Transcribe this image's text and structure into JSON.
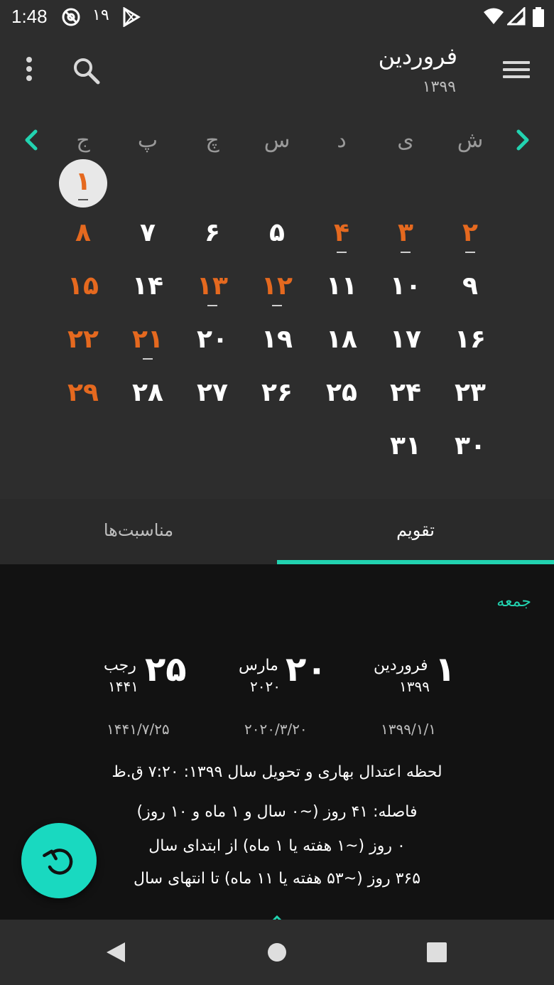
{
  "status_bar": {
    "time": "1:48",
    "notification_count": "۱۹"
  },
  "header": {
    "month": "فروردین",
    "year": "۱۳۹۹"
  },
  "weekdays": [
    "ش",
    "ی",
    "د",
    "س",
    "چ",
    "پ",
    "ج"
  ],
  "days": [
    {
      "label": "۱",
      "holiday": true,
      "event": true,
      "selected": true
    },
    {
      "label": "۲",
      "holiday": true,
      "event": true
    },
    {
      "label": "۳",
      "holiday": true,
      "event": true
    },
    {
      "label": "۴",
      "holiday": true,
      "event": true
    },
    {
      "label": "۵",
      "holiday": false,
      "event": false
    },
    {
      "label": "۶",
      "holiday": false,
      "event": false
    },
    {
      "label": "۷",
      "holiday": false,
      "event": false
    },
    {
      "label": "۸",
      "holiday": true,
      "event": false
    },
    {
      "label": "۹",
      "holiday": false,
      "event": false
    },
    {
      "label": "۱۰",
      "holiday": false,
      "event": false
    },
    {
      "label": "۱۱",
      "holiday": false,
      "event": false
    },
    {
      "label": "۱۲",
      "holiday": true,
      "event": true
    },
    {
      "label": "۱۳",
      "holiday": true,
      "event": true
    },
    {
      "label": "۱۴",
      "holiday": false,
      "event": false
    },
    {
      "label": "۱۵",
      "holiday": true,
      "event": false
    },
    {
      "label": "۱۶",
      "holiday": false,
      "event": false
    },
    {
      "label": "۱۷",
      "holiday": false,
      "event": false
    },
    {
      "label": "۱۸",
      "holiday": false,
      "event": false
    },
    {
      "label": "۱۹",
      "holiday": false,
      "event": false
    },
    {
      "label": "۲۰",
      "holiday": false,
      "event": false
    },
    {
      "label": "۲۱",
      "holiday": true,
      "event": true
    },
    {
      "label": "۲۲",
      "holiday": true,
      "event": false
    },
    {
      "label": "۲۳",
      "holiday": false,
      "event": false
    },
    {
      "label": "۲۴",
      "holiday": false,
      "event": false
    },
    {
      "label": "۲۵",
      "holiday": false,
      "event": false
    },
    {
      "label": "۲۶",
      "holiday": false,
      "event": false
    },
    {
      "label": "۲۷",
      "holiday": false,
      "event": false
    },
    {
      "label": "۲۸",
      "holiday": false,
      "event": false
    },
    {
      "label": "۲۹",
      "holiday": true,
      "event": false
    },
    {
      "label": "۳۰",
      "holiday": false,
      "event": false
    },
    {
      "label": "۳۱",
      "holiday": false,
      "event": false
    }
  ],
  "tabs": {
    "calendar": "تقویم",
    "events": "مناسبت‌ها"
  },
  "details": {
    "weekday": "جمعه",
    "persian": {
      "day": "۱",
      "month": "فروردین",
      "year": "۱۳۹۹",
      "numeric": "۱۳۹۹/۱/۱"
    },
    "gregorian": {
      "day": "۲۰",
      "month": "مارس",
      "year": "۲۰۲۰",
      "numeric": "۲۰۲۰/۳/۲۰"
    },
    "hijri": {
      "day": "۲۵",
      "month": "رجب",
      "year": "۱۴۴۱",
      "numeric": "۱۴۴۱/۷/۲۵"
    },
    "equinox": "لحظه اعتدال بهاری و تحویل سال ۱۳۹۹: ۷:۲۰ ق.ظ",
    "distance": "فاصله: ۴۱ روز (~۰ سال و ۱ ماه و ۱۰ روز)",
    "since_start": "۰ روز (~۱ هفته یا ۱ ماه) از ابتدای سال",
    "until_end": "۳۶۵ روز (~۵۳ هفته یا ۱۱ ماه) تا انتهای سال"
  },
  "colors": {
    "accent": "#22d3b0",
    "holiday": "#e5691f",
    "fab": "#19d9c0"
  }
}
